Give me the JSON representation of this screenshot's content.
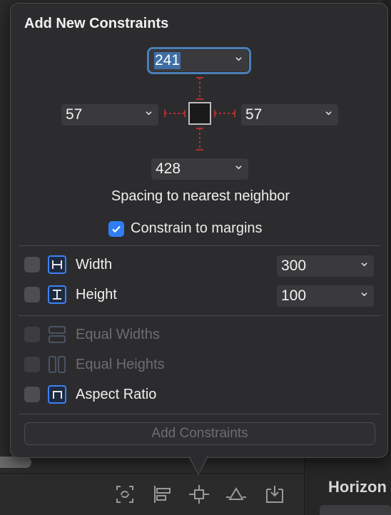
{
  "popover": {
    "title": "Add New Constraints",
    "top_value": "241",
    "left_value": "57",
    "right_value": "57",
    "bottom_value": "428",
    "spacing_label": "Spacing to nearest neighbor",
    "constrain_margins_label": "Constrain to margins",
    "constrain_margins_checked": true,
    "width": {
      "label": "Width",
      "value": "300",
      "checked": false,
      "enabled": true
    },
    "height": {
      "label": "Height",
      "value": "100",
      "checked": false,
      "enabled": true
    },
    "equal_widths": {
      "label": "Equal Widths",
      "checked": false,
      "enabled": false
    },
    "equal_heights": {
      "label": "Equal Heights",
      "checked": false,
      "enabled": false
    },
    "aspect_ratio": {
      "label": "Aspect Ratio",
      "checked": false,
      "enabled": true
    },
    "add_button_label": "Add Constraints"
  },
  "background": {
    "side_panel_label": "Horizon",
    "toolbar_icons": [
      "update-frames-icon",
      "align-icon",
      "add-constraints-icon",
      "resolve-issues-icon",
      "embed-in-icon"
    ]
  },
  "colors": {
    "accent": "#2f7ef5",
    "focus_ring": "#4a7fb8",
    "strut": "#b03030",
    "icon_blue": "#3b82f6"
  }
}
